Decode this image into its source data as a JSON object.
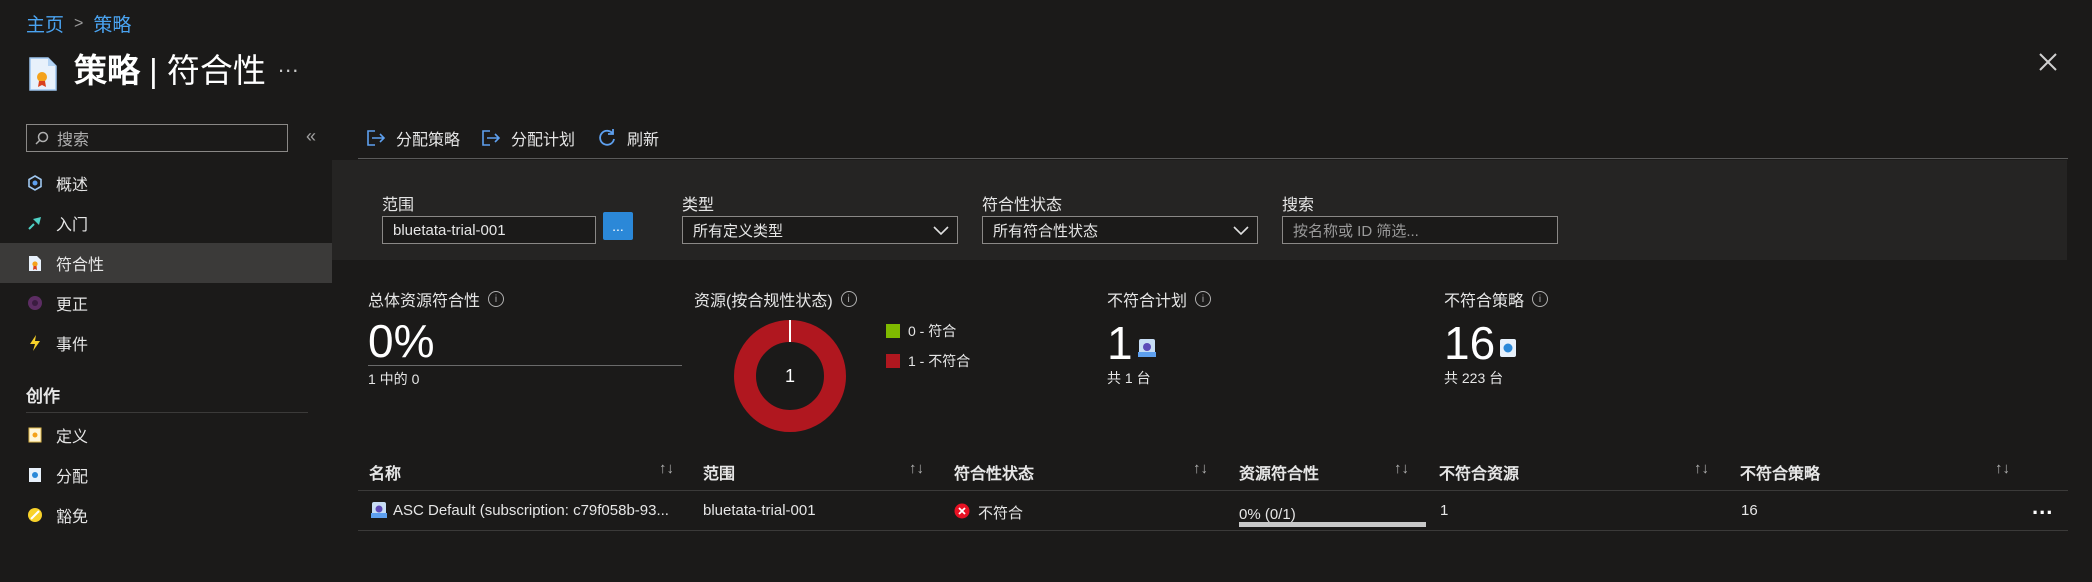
{
  "breadcrumb": {
    "home": "主页",
    "separator": ">",
    "current": "策略"
  },
  "header": {
    "title_main": "策略",
    "title_sep": " | ",
    "title_sub": "符合性",
    "more": "...",
    "close_icon": "close-icon"
  },
  "nav": {
    "search_placeholder": "搜索",
    "collapse": "«",
    "items": [
      {
        "label": "概述",
        "icon": "overview-icon"
      },
      {
        "label": "入门",
        "icon": "getting-started-icon"
      },
      {
        "label": "符合性",
        "icon": "compliance-icon",
        "active": true
      },
      {
        "label": "更正",
        "icon": "remediation-icon"
      },
      {
        "label": "事件",
        "icon": "events-icon"
      }
    ],
    "section": "创作",
    "authoring": [
      {
        "label": "定义",
        "icon": "definitions-icon"
      },
      {
        "label": "分配",
        "icon": "assignments-icon"
      },
      {
        "label": "豁免",
        "icon": "exemptions-icon"
      }
    ]
  },
  "toolbar": {
    "assign_policy": "分配策略",
    "assign_initiative": "分配计划",
    "refresh": "刷新"
  },
  "filters": {
    "scope_label": "范围",
    "scope_value": "bluetata-trial-001",
    "scope_button": "...",
    "type_label": "类型",
    "type_value": "所有定义类型",
    "compliance_label": "符合性状态",
    "compliance_value": "所有符合性状态",
    "search_label": "搜索",
    "search_placeholder": "按名称或 ID 筛选..."
  },
  "stats": {
    "overall_label": "总体资源符合性",
    "overall_value": "0%",
    "overall_sub": "1 中的 0",
    "resources_label": "资源(按合规性状态)",
    "donut_center": "1",
    "legend": [
      {
        "label": "0 - 符合",
        "color": "#7fba00"
      },
      {
        "label": "1 - 不符合",
        "color": "#b0171f"
      }
    ],
    "noncompliant_initiatives_label": "不符合计划",
    "noncompliant_initiatives_value": "1",
    "noncompliant_initiatives_sub": "共 1 台",
    "noncompliant_policies_label": "不符合策略",
    "noncompliant_policies_value": "16",
    "noncompliant_policies_sub": "共 223 台",
    "info": "i"
  },
  "chart_data": {
    "type": "pie",
    "categories": [
      "0 - 符合",
      "1 - 不符合"
    ],
    "values": [
      0,
      1
    ],
    "colors": [
      "#7fba00",
      "#b0171f"
    ]
  },
  "table": {
    "columns": [
      "名称",
      "范围",
      "符合性状态",
      "资源符合性",
      "不符合资源",
      "不符合策略"
    ],
    "sort_glyph": "↑↓",
    "rows": [
      {
        "name": "ASC Default (subscription: c79f058b-93...",
        "scope": "bluetata-trial-001",
        "state": "不符合",
        "resource_compliance": "0% (0/1)",
        "compliance_fraction": 0,
        "noncompliant_resources": "1",
        "noncompliant_policies": "16",
        "more": "..."
      }
    ]
  }
}
